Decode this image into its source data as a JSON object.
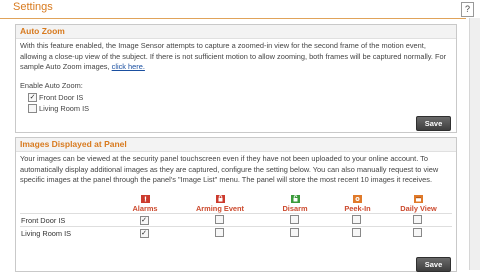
{
  "page": {
    "title": "Settings",
    "help": "?"
  },
  "auto_zoom": {
    "header": "Auto Zoom",
    "description": "With this feature enabled, the Image Sensor attempts to capture a zoomed-in view for the second frame of the motion event, allowing a close-up view of the subject. If there is not sufficient motion to allow zooming, both frames will be captured normally. For sample Auto Zoom images,",
    "link": "click here.",
    "enable_label": "Enable Auto Zoom:",
    "cameras": [
      {
        "name": "Front Door IS",
        "checked": true
      },
      {
        "name": "Living Room IS",
        "checked": false
      }
    ],
    "save_label": "Save"
  },
  "images_panel": {
    "header": "Images Displayed at Panel",
    "description": "Your images can be viewed at the security panel touchscreen even if they have not been uploaded to your online account. To automatically display additional images as they are captured, configure the setting below. You can also manually request to view specific images at the panel through the panel's \"Image List\" menu. The panel will store the most recent 10 images it receives.",
    "columns": [
      {
        "label": "Alarms",
        "icon": "alarm-icon",
        "color": "#cc3b2e"
      },
      {
        "label": "Arming Event",
        "icon": "arming-icon",
        "color": "#cc3b2e"
      },
      {
        "label": "Disarm",
        "icon": "disarm-icon",
        "color": "#3a9a3a"
      },
      {
        "label": "Peek-In",
        "icon": "peek-in-icon",
        "color": "#e07a2a"
      },
      {
        "label": "Daily View",
        "icon": "daily-view-icon",
        "color": "#e07a2a"
      }
    ],
    "rows": [
      {
        "name": "Front Door IS",
        "checks": [
          true,
          false,
          false,
          false,
          false
        ]
      },
      {
        "name": "Living Room IS",
        "checks": [
          true,
          false,
          false,
          false,
          false
        ]
      }
    ],
    "save_label": "Save"
  },
  "check_glyph": "✓"
}
